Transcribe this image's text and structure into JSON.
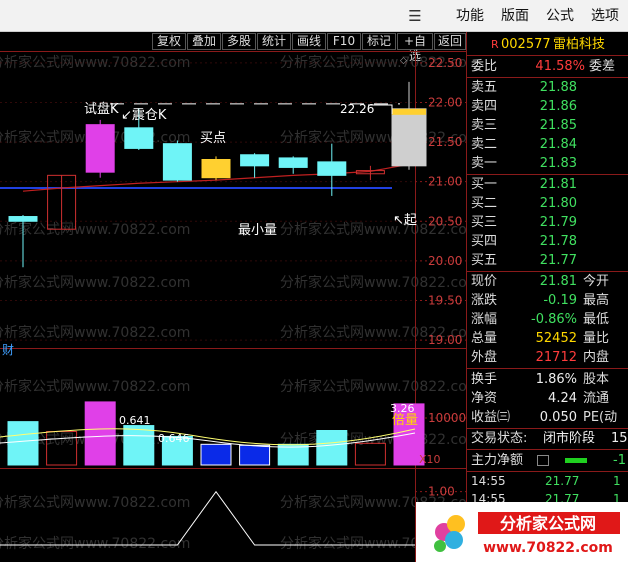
{
  "menu": {
    "items": [
      "功能",
      "版面",
      "公式",
      "选项"
    ]
  },
  "toolbar": {
    "buttons": [
      "复权",
      "叠加",
      "多股",
      "统计",
      "画线",
      "F10",
      "标记",
      "+自选",
      "返回"
    ]
  },
  "stock": {
    "marker": "R",
    "code": "002577",
    "name": "雷柏科技"
  },
  "quote": {
    "weibi_label": "委比",
    "weibi_value": "41.58%",
    "weicha_label": "委差",
    "sell": [
      {
        "label": "卖五",
        "price": "21.88"
      },
      {
        "label": "卖四",
        "price": "21.86"
      },
      {
        "label": "卖三",
        "price": "21.85"
      },
      {
        "label": "卖二",
        "price": "21.84"
      },
      {
        "label": "卖一",
        "price": "21.83"
      }
    ],
    "buy": [
      {
        "label": "买一",
        "price": "21.81"
      },
      {
        "label": "买二",
        "price": "21.80"
      },
      {
        "label": "买三",
        "price": "21.79"
      },
      {
        "label": "买四",
        "price": "21.78"
      },
      {
        "label": "买五",
        "price": "21.77"
      }
    ],
    "stats": [
      {
        "label": "现价",
        "value": "21.81",
        "color": "green",
        "extra": "今开"
      },
      {
        "label": "涨跌",
        "value": "-0.19",
        "color": "green",
        "extra": "最高"
      },
      {
        "label": "涨幅",
        "value": "-0.86%",
        "color": "green",
        "extra": "最低"
      },
      {
        "label": "总量",
        "value": "52452",
        "color": "yellow",
        "extra": "量比"
      },
      {
        "label": "外盘",
        "value": "21712",
        "color": "red",
        "extra": "内盘"
      }
    ],
    "stats2": [
      {
        "label": "换手",
        "value": "1.86%",
        "extra": "股本"
      },
      {
        "label": "净资",
        "value": "4.24",
        "extra": "流通"
      },
      {
        "label": "收益㈢",
        "value": "0.050",
        "extra": "PE(动"
      }
    ],
    "trade_status_label": "交易状态:",
    "trade_status_value": "闭市阶段",
    "trade_status_extra": "15",
    "main_net_label": "主力净额",
    "main_net_value": "-1",
    "ticks": [
      {
        "time": "14:55",
        "price": "21.77",
        "vol": "1"
      },
      {
        "time": "14:55",
        "price": "21.77",
        "vol": "1"
      }
    ]
  },
  "chart": {
    "y_axis_labels": [
      "22.50",
      "22.00",
      "21.50",
      "21.00",
      "20.50",
      "20.00",
      "19.50",
      "19.00"
    ],
    "annotations": {
      "shi_pan": "试盘K",
      "zhen_cang": "↙震仓K",
      "mai_dian": "买点",
      "zui_xiao_liang": "最小量",
      "qi": "↖起",
      "high_label": "22.26"
    },
    "finance_tag": "财",
    "vol_axis_label": "10000",
    "vol_multiplier": "X10",
    "vol_annotations": {
      "v1": "0.641",
      "v2": "0.646",
      "v3": "3.26",
      "bei_liang": "倍量"
    },
    "sub_axis_labels": [
      "1.00",
      "0.50",
      "0.00"
    ],
    "watermark": "分析家公式网www.70822.com"
  },
  "chart_data": {
    "type": "candlestick",
    "y_range": [
      18.9,
      22.65
    ],
    "candles": [
      {
        "open": 20.5,
        "close": 20.56,
        "high": 20.58,
        "low": 19.92,
        "style": "cyan"
      },
      {
        "open": 20.4,
        "close": 21.08,
        "high": 21.08,
        "low": 20.4,
        "style": "hollow-red"
      },
      {
        "open": 21.12,
        "close": 21.72,
        "high": 21.78,
        "low": 21.05,
        "style": "magenta"
      },
      {
        "open": 21.68,
        "close": 21.42,
        "high": 21.93,
        "low": 21.4,
        "style": "cyan"
      },
      {
        "open": 21.48,
        "close": 21.02,
        "high": 21.52,
        "low": 21.0,
        "style": "cyan"
      },
      {
        "open": 21.05,
        "close": 21.28,
        "high": 21.32,
        "low": 21.02,
        "style": "yellow"
      },
      {
        "open": 21.34,
        "close": 21.2,
        "high": 21.36,
        "low": 21.05,
        "style": "cyan"
      },
      {
        "open": 21.3,
        "close": 21.18,
        "high": 21.32,
        "low": 21.1,
        "style": "cyan"
      },
      {
        "open": 21.25,
        "close": 21.08,
        "high": 21.48,
        "low": 20.82,
        "style": "cyan"
      },
      {
        "open": 21.1,
        "close": 21.14,
        "high": 21.2,
        "low": 21.02,
        "style": "hollow-red"
      },
      {
        "open": 21.2,
        "close": 21.92,
        "high": 22.26,
        "low": 21.15,
        "style": "gray"
      }
    ],
    "volumes": [
      2200,
      1700,
      3200,
      2000,
      1450,
      1050,
      1000,
      1050,
      1750,
      1100,
      3100
    ],
    "vol_styles": [
      "cyan",
      "hollow-red",
      "magenta",
      "cyan",
      "cyan",
      "blue",
      "blue",
      "cyan",
      "cyan",
      "hollow-red",
      "magenta"
    ],
    "vol_range": [
      0,
      3500
    ],
    "sub_values": [
      0,
      0,
      0,
      0,
      0,
      1,
      0,
      0,
      0,
      0,
      0
    ],
    "sub_range": [
      0,
      1.2
    ],
    "buy_level": 21.92,
    "blue_line": 20.92,
    "colors": {
      "cyan": "#6ff4f7",
      "magenta": "#e040e8",
      "yellow": "#ffd030",
      "blue": "#0a2ae8",
      "red_frame": "#d03030",
      "gray": "#cfcfcf",
      "ma_red": "#c02020",
      "blue_line": "#2040e0"
    }
  }
}
